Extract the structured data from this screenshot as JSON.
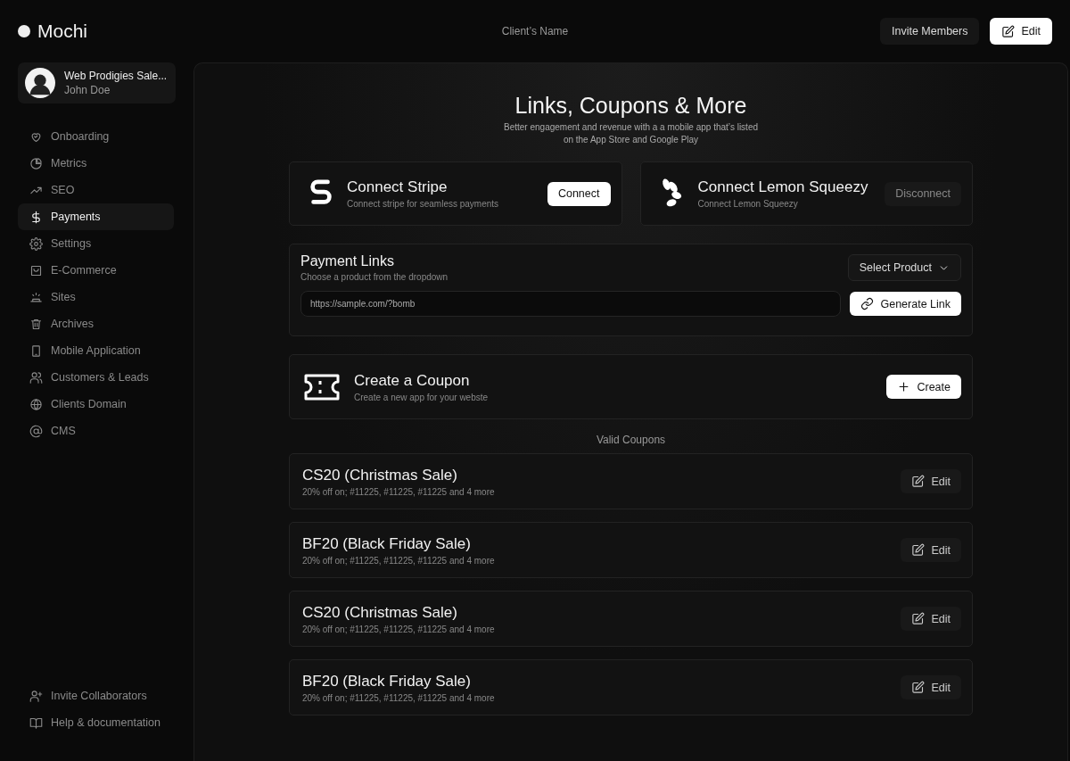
{
  "brand": {
    "name": "Mochi"
  },
  "header": {
    "title": "Client’s Name",
    "buttons": [
      {
        "label": "Invite Members",
        "kind": "secondary"
      },
      {
        "label": "Edit",
        "kind": "primary"
      }
    ]
  },
  "account": {
    "name": "Web Prodigies Sale...",
    "user": "John Doe"
  },
  "sidebar": {
    "items": [
      {
        "label": "Onboarding",
        "selected": false
      },
      {
        "label": "Metrics",
        "selected": false
      },
      {
        "label": "SEO",
        "selected": false
      },
      {
        "label": "Payments",
        "selected": true
      },
      {
        "label": "Settings",
        "selected": false
      },
      {
        "label": "E-Commerce",
        "selected": false
      },
      {
        "label": "Sites",
        "selected": false
      },
      {
        "label": "Archives",
        "selected": false
      },
      {
        "label": "Mobile Application",
        "selected": false
      },
      {
        "label": "Customers & Leads",
        "selected": false
      },
      {
        "label": "Clients Domain",
        "selected": false
      },
      {
        "label": "CMS",
        "selected": false
      }
    ],
    "footer_items": [
      {
        "label": "Invite Collaborators"
      },
      {
        "label": "Help & documentation"
      }
    ]
  },
  "page": {
    "title": "Links, Coupons & More",
    "subtitle": "Better engagement and revenue with a a mobile app that’s listed on the App Store and Google Play"
  },
  "integrations": [
    {
      "title": "Connect Stripe",
      "description": "Connect stripe for seamless payments",
      "button": {
        "label": "Connect",
        "kind": "primary"
      }
    },
    {
      "title": "Connect Lemon Squeezy",
      "description": "Connect Lemon Squeezy",
      "button": {
        "label": "Disconnect",
        "kind": "muted"
      }
    }
  ],
  "payment_links": {
    "title": "Payment Links",
    "description": "Choose a product from the dropdown",
    "select": {
      "label": "Select Product"
    },
    "url_field": {
      "value": "https://sample.com/?bomb"
    },
    "button": "Generate Link"
  },
  "coupon_create": {
    "title": "Create a Coupon",
    "description": "Create a new app for your webste",
    "button": "Create"
  },
  "coupons_heading": "Valid Coupons",
  "coupons": [
    {
      "title": "CS20 (Christmas Sale)",
      "description": "20% off on; #11225, #11225, #11225 and 4 more",
      "button": "Edit"
    },
    {
      "title": "BF20 (Black Friday Sale)",
      "description": "20% off on; #11225, #11225, #11225 and 4 more",
      "button": "Edit"
    },
    {
      "title": "CS20 (Christmas Sale)",
      "description": "20% off on; #11225, #11225, #11225 and 4 more",
      "button": "Edit"
    },
    {
      "title": "BF20 (Black Friday Sale)",
      "description": "20% off on; #11225, #11225, #11225 and 4 more",
      "button": "Edit"
    }
  ]
}
